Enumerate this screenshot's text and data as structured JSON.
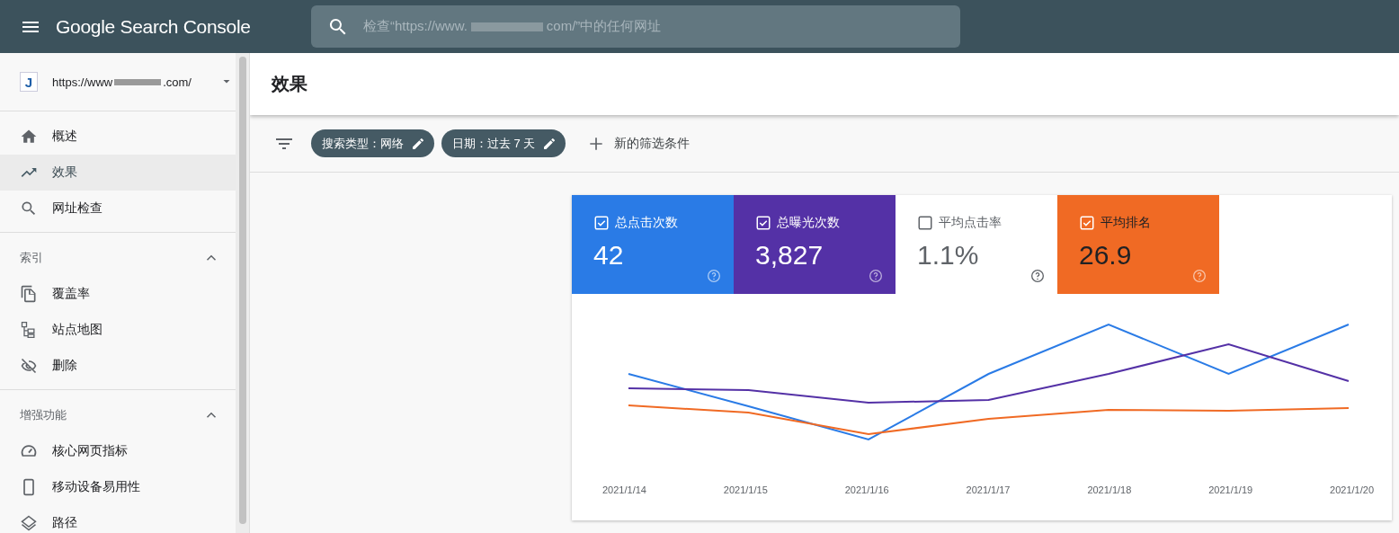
{
  "app": {
    "title": "Google Search Console"
  },
  "search": {
    "placeholder_prefix": "检查“https://www.",
    "placeholder_suffix": "com/”中的任何网址"
  },
  "property": {
    "url_prefix": "https://www",
    "url_suffix": ".com/",
    "badge": "J"
  },
  "sidebar": {
    "sections": [
      {
        "items": [
          {
            "label": "概述",
            "selected": false
          },
          {
            "label": "效果",
            "selected": true
          },
          {
            "label": "网址检查",
            "selected": false
          }
        ]
      },
      {
        "title": "索引",
        "expanded": true,
        "items": [
          {
            "label": "覆盖率",
            "selected": false
          },
          {
            "label": "站点地图",
            "selected": false
          },
          {
            "label": "删除",
            "selected": false
          }
        ]
      },
      {
        "title": "增强功能",
        "expanded": true,
        "items": [
          {
            "label": "核心网页指标",
            "selected": false
          },
          {
            "label": "移动设备易用性",
            "selected": false
          },
          {
            "label": "路径",
            "selected": false
          }
        ]
      }
    ]
  },
  "page": {
    "title": "效果"
  },
  "filters": {
    "chips": [
      {
        "label": "搜索类型：网络"
      },
      {
        "label": "日期：过去 7 天"
      }
    ],
    "add_label": "新的筛选条件"
  },
  "metrics": [
    {
      "label": "总点击次数",
      "value": "42",
      "checked": true,
      "color": "#2a7be6"
    },
    {
      "label": "总曝光次数",
      "value": "3,827",
      "checked": true,
      "color": "#5431a6"
    },
    {
      "label": "平均点击率",
      "value": "1.1%",
      "checked": false
    },
    {
      "label": "平均排名",
      "value": "26.9",
      "checked": true,
      "color": "#f06a24"
    }
  ],
  "chart": {
    "x_labels": [
      "2021/1/14",
      "2021/1/15",
      "2021/1/16",
      "2021/1/17",
      "2021/1/18",
      "2021/1/19",
      "2021/1/20"
    ]
  }
}
